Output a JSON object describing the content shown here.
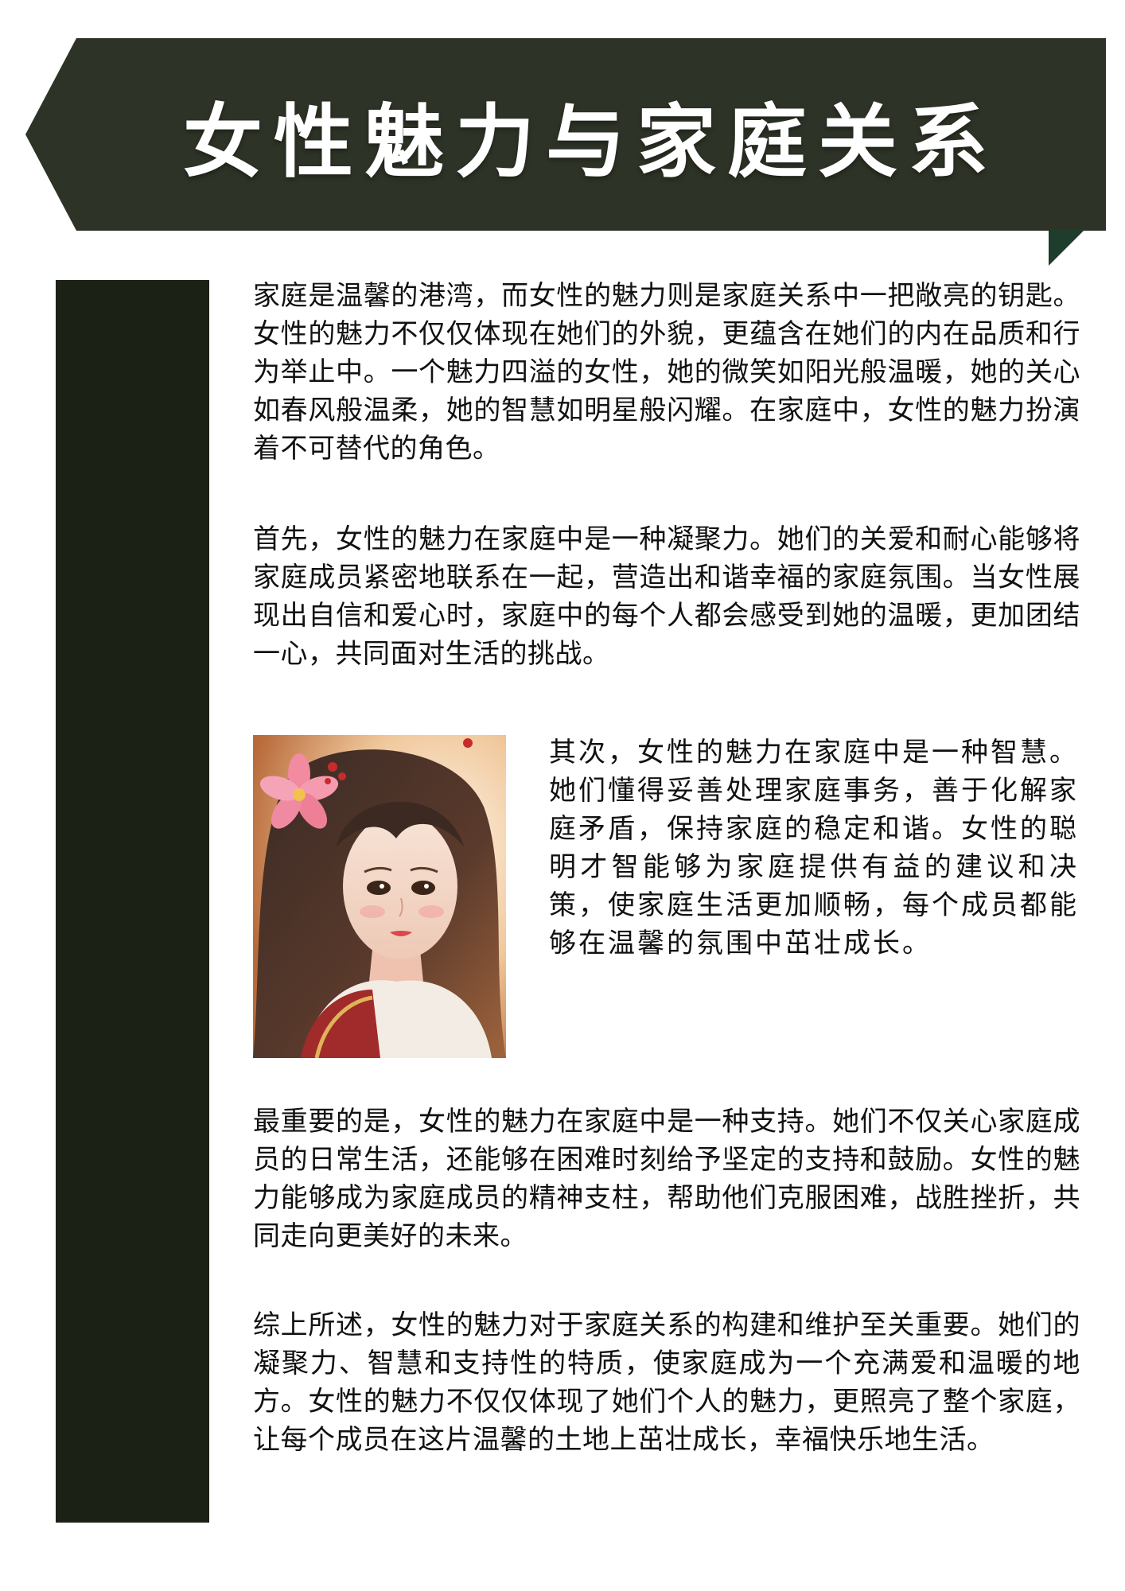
{
  "header": {
    "title": "女性魅力与家庭关系"
  },
  "article": {
    "paragraphs": [
      "家庭是温馨的港湾，而女性的魅力则是家庭关系中一把敞亮的钥匙。女性的魅力不仅仅体现在她们的外貌，更蕴含在她们的内在品质和行为举止中。一个魅力四溢的女性，她的微笑如阳光般温暖，她的关心如春风般温柔，她的智慧如明星般闪耀。在家庭中，女性的魅力扮演着不可替代的角色。",
      "首先，女性的魅力在家庭中是一种凝聚力。她们的关爱和耐心能够将家庭成员紧密地联系在一起，营造出和谐幸福的家庭氛围。当女性展现出自信和爱心时，家庭中的每个人都会感受到她的温暖，更加团结一心，共同面对生活的挑战。",
      "其次，女性的魅力在家庭中是一种智慧。她们懂得妥善处理家庭事务，善于化解家庭矛盾，保持家庭的稳定和谐。女性的聪明才智能够为家庭提供有益的建议和决策，使家庭生活更加顺畅，每个成员都能够在温馨的氛围中茁壮成长。",
      "最重要的是，女性的魅力在家庭中是一种支持。她们不仅关心家庭成员的日常生活，还能够在困难时刻给予坚定的支持和鼓励。女性的魅力能够成为家庭成员的精神支柱，帮助他们克服困难，战胜挫折，共同走向更美好的未来。",
      "综上所述，女性的魅力对于家庭关系的构建和维护至关重要。她们的凝聚力、智慧和支持性的特质，使家庭成为一个充满爱和温暖的地方。女性的魅力不仅仅体现了她们个人的魅力，更照亮了整个家庭，让每个成员在这片温馨的土地上茁壮成长，幸福快乐地生活。"
    ]
  },
  "colors": {
    "banner": "#2d3326",
    "side_bar": "#1b2114",
    "banner_fold": "#1f4a32",
    "title_text": "#ffffff",
    "body_text": "#111111"
  },
  "image": {
    "subject": "illustrated portrait of a woman with a pink flower in her hair"
  }
}
